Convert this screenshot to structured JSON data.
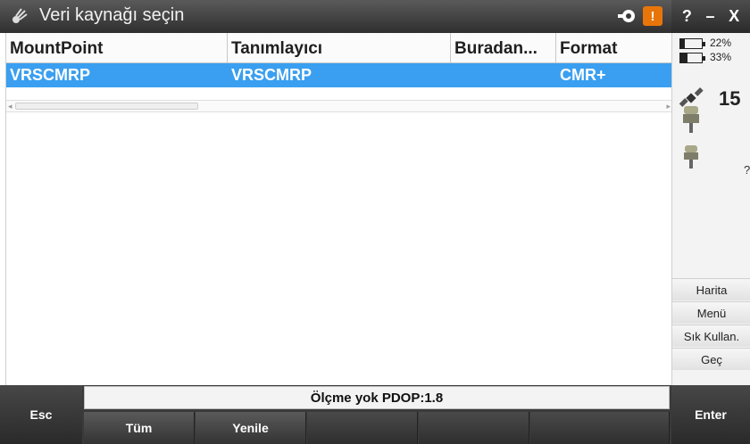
{
  "window": {
    "title": "Veri kaynağı seçin"
  },
  "title_controls": {
    "help": "?",
    "minimize": "–",
    "close": "X"
  },
  "table": {
    "columns": [
      "MountPoint",
      "Tanımlayıcı",
      "Buradan...",
      "Format"
    ],
    "rows": [
      {
        "mountpoint": "VRSCMRP",
        "identifier": "VRSCMRP",
        "from": "",
        "format": "CMR+"
      }
    ]
  },
  "side_panel": {
    "battery1_pct": "22%",
    "battery2_pct": "33%",
    "battery1_level": 0.22,
    "battery2_level": 0.33,
    "satellites": "15",
    "receiver_status": "?",
    "buttons": [
      "Harita",
      "Menü",
      "Sık Kullan.",
      "Geç"
    ]
  },
  "status_line": "Ölçme yok  PDOP:1.8",
  "bottom": {
    "esc": "Esc",
    "enter": "Enter",
    "fkeys": [
      "Tüm",
      "Yenile",
      "",
      "",
      ""
    ]
  },
  "colors": {
    "selection": "#3a9ff0",
    "warning": "#e8750a"
  },
  "icons": [
    "data-source-icon",
    "key-icon",
    "warning-icon",
    "battery-icon",
    "satellite-icon",
    "receiver-icon"
  ]
}
